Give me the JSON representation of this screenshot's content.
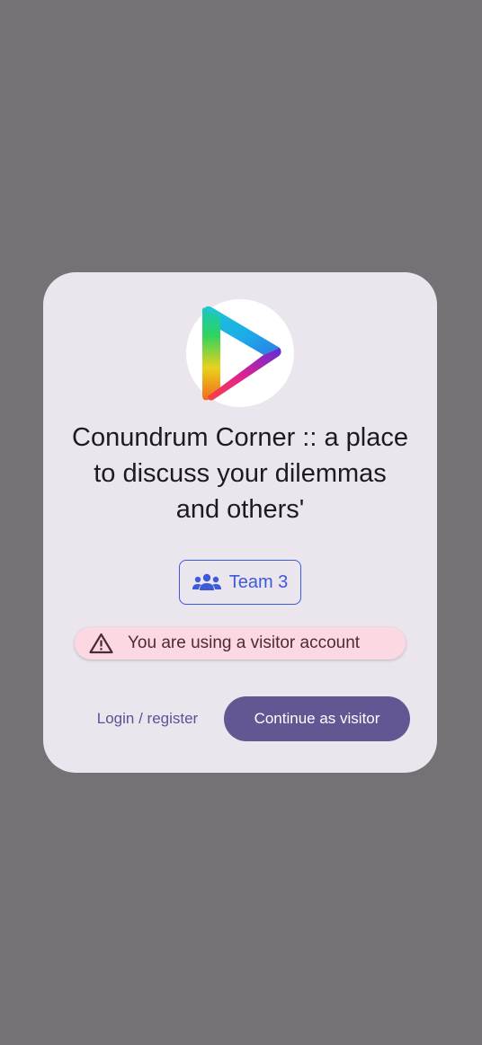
{
  "dialog": {
    "logo_icon": "rainbow-play-triangle-logo",
    "title": "Conundrum Corner :: a place to discuss your dilemmas and others'",
    "team_chip": {
      "icon": "group-icon",
      "label": "Team 3"
    },
    "warning": {
      "icon": "warning-triangle-icon",
      "text": "You are using a visitor account"
    },
    "actions": {
      "login_label": "Login / register",
      "continue_label": "Continue as visitor"
    }
  },
  "colors": {
    "scrim": "#747275",
    "dialog_background": "#ebe5ee",
    "primary": "#645593",
    "team_accent": "#3d5ad8",
    "warning_background": "#fcd8e2",
    "warning_text": "#4e2a37"
  }
}
